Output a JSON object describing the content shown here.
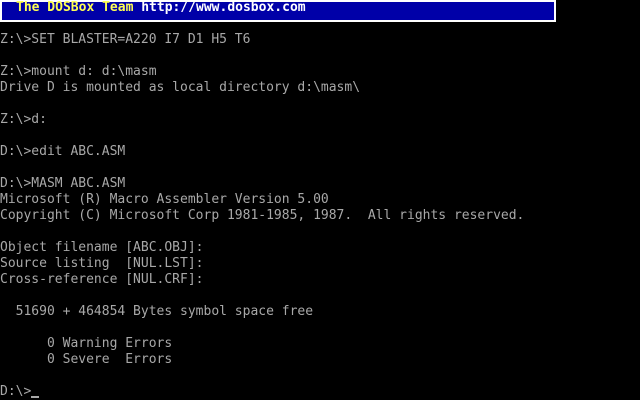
{
  "banner": {
    "team": "The DOSBox Team",
    "url": "http://www.dosbox.com"
  },
  "terminal": {
    "lines": [
      "Z:\\>SET BLASTER=A220 I7 D1 H5 T6",
      "",
      "Z:\\>mount d: d:\\masm",
      "Drive D is mounted as local directory d:\\masm\\",
      "",
      "Z:\\>d:",
      "",
      "D:\\>edit ABC.ASM",
      "",
      "D:\\>MASM ABC.ASM",
      "Microsoft (R) Macro Assembler Version 5.00",
      "Copyright (C) Microsoft Corp 1981-1985, 1987.  All rights reserved.",
      "",
      "Object filename [ABC.OBJ]:",
      "Source listing  [NUL.LST]:",
      "Cross-reference [NUL.CRF]:",
      "",
      "  51690 + 464854 Bytes symbol space free",
      "",
      "      0 Warning Errors",
      "      0 Severe  Errors",
      ""
    ],
    "prompt": "D:\\>"
  },
  "colors": {
    "background": "#000000",
    "text": "#a8a8a8",
    "banner_bg": "#0000a8",
    "banner_text": "#ffff54"
  }
}
